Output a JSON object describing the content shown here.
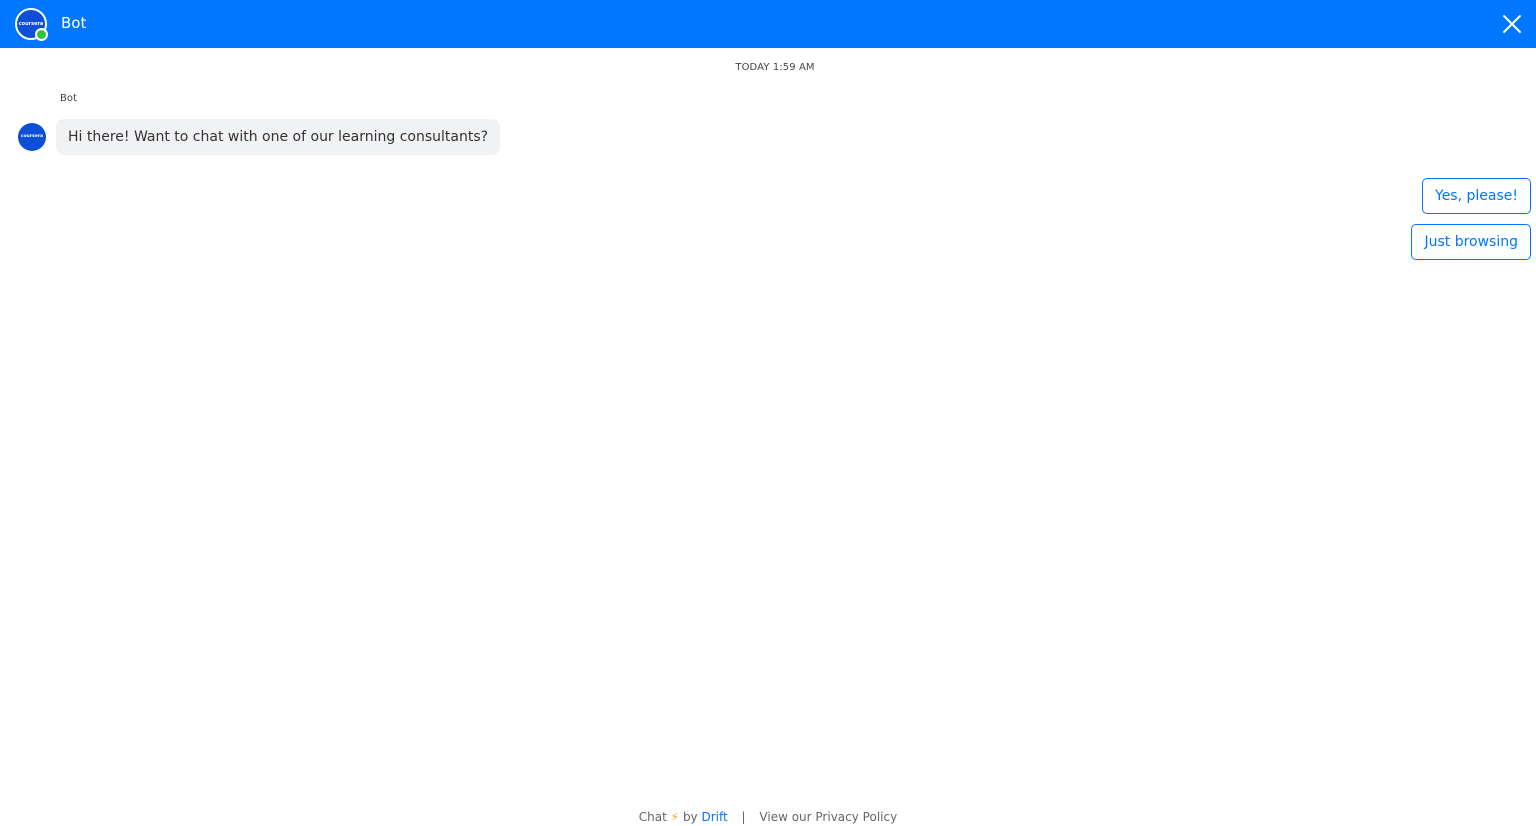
{
  "header": {
    "avatar_logo_text": "coursera",
    "title": "Bot",
    "close_icon": "close-icon"
  },
  "conversation": {
    "timestamp": "TODAY 1:59 AM",
    "sender_name": "Bot",
    "bot_avatar_logo_text": "coursera",
    "message": "Hi there! Want to chat with one of our learning consultants?"
  },
  "choices": [
    {
      "label": "Yes, please!"
    },
    {
      "label": "Just browsing"
    }
  ],
  "footer": {
    "chat_label": "Chat",
    "bolt_glyph": "⚡",
    "by_label": "by",
    "drift_link": "Drift",
    "separator": "|",
    "privacy_link": "View our Privacy Policy"
  },
  "colors": {
    "header_bg": "#0176ff",
    "online_status": "#32c53b",
    "accent": "#0176ff",
    "bubble_bg": "#f1f2f4"
  }
}
